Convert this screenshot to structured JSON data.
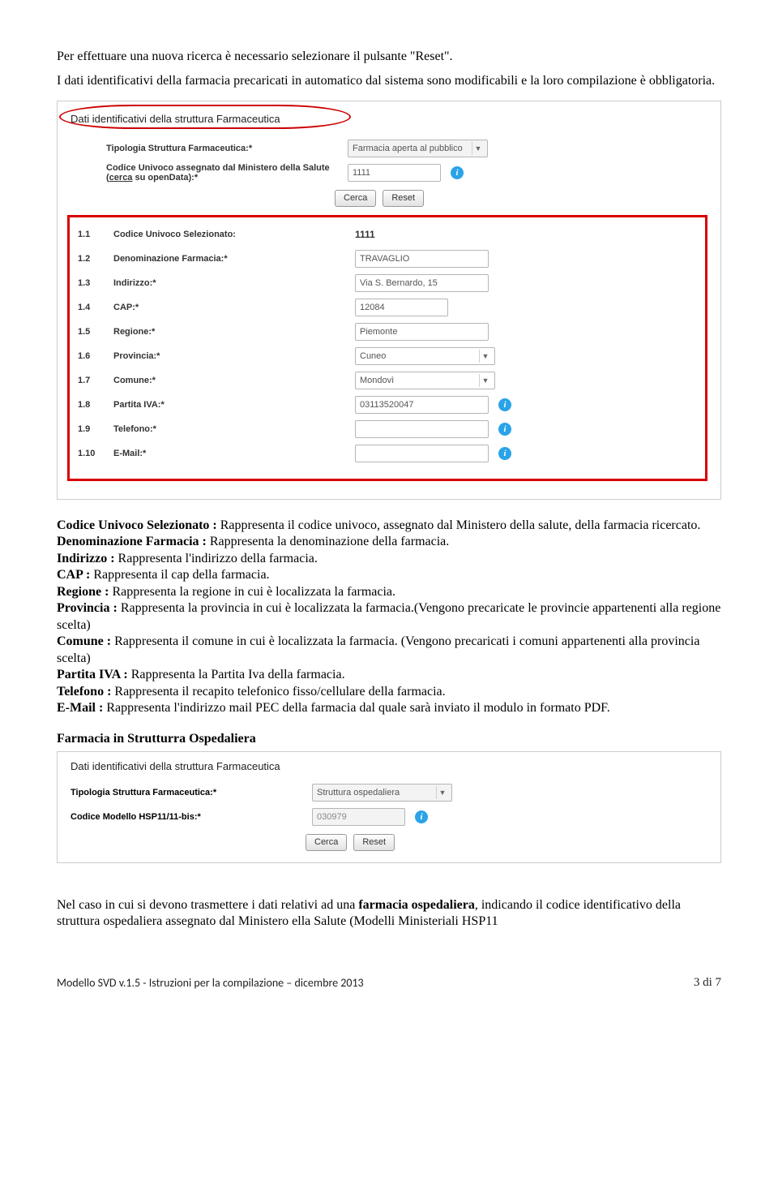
{
  "intro": {
    "line1": "Per effettuare una nuova ricerca è necessario selezionare il pulsante \"Reset\".",
    "line2": "I dati identificativi della farmacia precaricati in automatico dal sistema sono modificabili e la loro compilazione è obbligatoria."
  },
  "panel1": {
    "title": "Dati identificativi della struttura Farmaceutica",
    "top": {
      "label_tipologia": "Tipologia Struttura Farmaceutica:*",
      "tipologia_value": "Farmacia aperta al pubblico",
      "label_codice": "Codice Univoco assegnato dal Ministero della Salute (",
      "cerca_link": "cerca",
      "label_codice_end": " su openData):*",
      "codice_value": "1111",
      "btn_cerca": "Cerca",
      "btn_reset": "Reset"
    },
    "rows": [
      {
        "num": "1.1",
        "label": "Codice Univoco Selezionato:",
        "type": "plain",
        "value": "1111"
      },
      {
        "num": "1.2",
        "label": "Denominazione Farmacia:*",
        "type": "input",
        "value": "TRAVAGLIO"
      },
      {
        "num": "1.3",
        "label": "Indirizzo:*",
        "type": "input",
        "value": "Via S. Bernardo, 15"
      },
      {
        "num": "1.4",
        "label": "CAP:*",
        "type": "input",
        "value": "12084"
      },
      {
        "num": "1.5",
        "label": "Regione:*",
        "type": "input",
        "value": "Piemonte"
      },
      {
        "num": "1.6",
        "label": "Provincia:*",
        "type": "select",
        "value": "Cuneo"
      },
      {
        "num": "1.7",
        "label": "Comune:*",
        "type": "select",
        "value": "Mondovì"
      },
      {
        "num": "1.8",
        "label": "Partita IVA:*",
        "type": "input",
        "value": "03113520047",
        "info": true
      },
      {
        "num": "1.9",
        "label": "Telefono:*",
        "type": "input",
        "value": "",
        "info": true
      },
      {
        "num": "1.10",
        "label": "E-Mail:*",
        "type": "input",
        "value": "",
        "info": true
      }
    ]
  },
  "descriptions": {
    "d1_label": "Codice Univoco Selezionato : ",
    "d1_text": "Rappresenta il codice univoco, assegnato dal Ministero della salute, della farmacia ricercato.",
    "d2_label": "Denominazione Farmacia : ",
    "d2_text": "Rappresenta la denominazione della farmacia.",
    "d3_label": "Indirizzo : ",
    "d3_text": "Rappresenta l'indirizzo della farmacia.",
    "d4_label": "CAP : ",
    "d4_text": "Rappresenta il cap della farmacia.",
    "d5_label": "Regione : ",
    "d5_text": "Rappresenta la regione in cui è localizzata la farmacia.",
    "d6_label": "Provincia : ",
    "d6_text": "Rappresenta la provincia in cui è localizzata la farmacia.(Vengono precaricate le provincie appartenenti alla regione scelta)",
    "d7_label": "Comune : ",
    "d7_text": "Rappresenta il comune in cui è localizzata la farmacia. (Vengono precaricati i comuni appartenenti alla provincia scelta)",
    "d8_label": "Partita IVA : ",
    "d8_text": "Rappresenta la Partita Iva della farmacia.",
    "d9_label": "Telefono : ",
    "d9_text": "Rappresenta il recapito telefonico fisso/cellulare della farmacia.",
    "d10_label": "E-Mail : ",
    "d10_text": "Rappresenta l'indirizzo mail PEC della farmacia dal quale sarà inviato il modulo in formato PDF."
  },
  "subheading": "Farmacia in Strutturra Ospedaliera",
  "panel2": {
    "title": "Dati identificativi della struttura Farmaceutica",
    "label_tipologia": "Tipologia Struttura Farmaceutica:*",
    "tipologia_value": "Struttura ospedaliera",
    "label_codice": "Codice Modello HSP11/11-bis:*",
    "codice_value": "030979",
    "btn_cerca": "Cerca",
    "btn_reset": "Reset"
  },
  "closing": {
    "text_prefix": "Nel caso in cui si devono trasmettere i dati relativi ad una ",
    "bold": "farmacia ospedaliera",
    "text_suffix": ", indicando il codice identificativo della struttura ospedaliera assegnato dal Ministero ella Salute (Modelli Ministeriali HSP11"
  },
  "footer": {
    "left": "Modello SVD v.1.5 - Istruzioni per la compilazione – dicembre 2013",
    "right": "3 di 7"
  }
}
